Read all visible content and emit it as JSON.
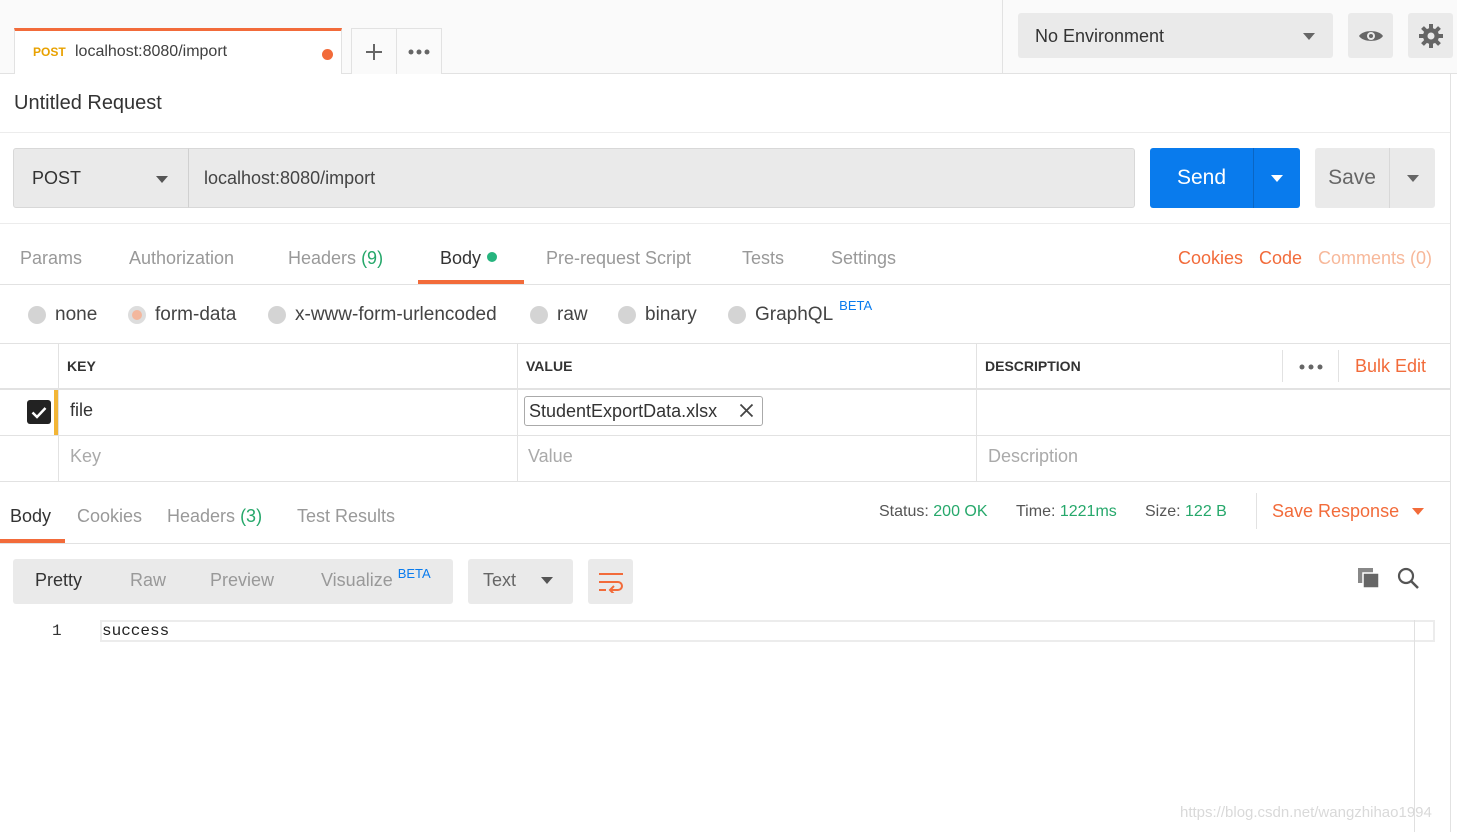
{
  "tabbar": {
    "tab_method": "POST",
    "tab_title": "localhost:8080/import",
    "environment": "No Environment"
  },
  "request": {
    "name": "Untitled Request",
    "method": "POST",
    "url": "localhost:8080/import",
    "send_label": "Send",
    "save_label": "Save"
  },
  "request_tabs": {
    "params": "Params",
    "authorization": "Authorization",
    "headers": "Headers",
    "headers_count": "(9)",
    "body": "Body",
    "prerequest": "Pre-request Script",
    "tests": "Tests",
    "settings": "Settings",
    "cookies": "Cookies",
    "code": "Code",
    "comments": "Comments (0)"
  },
  "body_types": {
    "none": "none",
    "form_data": "form-data",
    "urlencoded": "x-www-form-urlencoded",
    "raw": "raw",
    "binary": "binary",
    "graphql": "GraphQL",
    "beta": "BETA",
    "selected": "form-data"
  },
  "table": {
    "headers": {
      "key": "KEY",
      "value": "VALUE",
      "description": "DESCRIPTION",
      "bulk_edit": "Bulk Edit"
    },
    "rows": [
      {
        "key": "file",
        "value": "StudentExportData.xlsx",
        "checked": true
      }
    ],
    "placeholders": {
      "key": "Key",
      "value": "Value",
      "description": "Description"
    }
  },
  "response": {
    "tabs": {
      "body": "Body",
      "cookies": "Cookies",
      "headers": "Headers",
      "headers_count": "(3)",
      "test_results": "Test Results"
    },
    "status_label": "Status:",
    "status_value": "200 OK",
    "time_label": "Time:",
    "time_value": "1221ms",
    "size_label": "Size:",
    "size_value": "122 B",
    "save_response": "Save Response",
    "view_modes": {
      "pretty": "Pretty",
      "raw": "Raw",
      "preview": "Preview",
      "visualize": "Visualize",
      "beta": "BETA"
    },
    "format": "Text",
    "lines": [
      {
        "num": "1",
        "text": "success"
      }
    ]
  },
  "watermark": "https://blog.csdn.net/wangzhihao1994",
  "colors": {
    "accent": "#f26b3a",
    "send": "#097bed",
    "success": "#26a86b",
    "method_tab": "#e8a100"
  }
}
